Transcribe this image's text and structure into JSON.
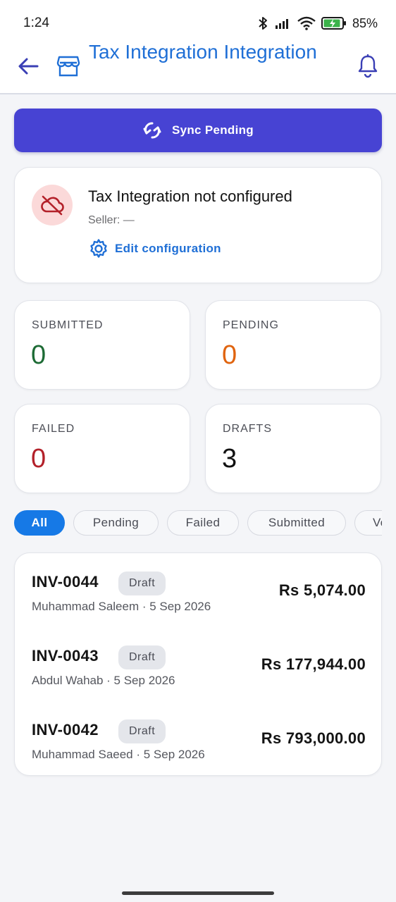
{
  "status_bar": {
    "time": "1:24",
    "battery": "85%"
  },
  "app_bar": {
    "title": "Tax Integration Integration",
    "icons": [
      "back-arrow-icon",
      "storefront-icon",
      "bell-icon"
    ]
  },
  "sync_button": {
    "label": "Sync Pending",
    "icon": "sync-icon"
  },
  "config_card": {
    "title": "Tax Integration not configured",
    "seller": "Seller: —",
    "edit_label": "Edit configuration",
    "icons": [
      "cloud-off-icon",
      "gear-icon"
    ]
  },
  "stats": [
    {
      "label": "SUBMITTED",
      "value": "0",
      "color": "#1d6b35"
    },
    {
      "label": "PENDING",
      "value": "0",
      "color": "#e0640f"
    },
    {
      "label": "FAILED",
      "value": "0",
      "color": "#b3212a"
    },
    {
      "label": "DRAFTS",
      "value": "3",
      "color": "#111111"
    }
  ],
  "filters": {
    "chips": [
      "All",
      "Pending",
      "Failed",
      "Submitted",
      "Void"
    ],
    "selected": "All"
  },
  "invoices": [
    {
      "id": "INV-0044",
      "status": "Draft",
      "meta": "Muhammad Saleem · 5 Sep 2026",
      "amount": "Rs 5,074.00"
    },
    {
      "id": "INV-0043",
      "status": "Draft",
      "meta": "Abdul Wahab · 5 Sep 2026",
      "amount": "Rs 177,944.00"
    },
    {
      "id": "INV-0042",
      "status": "Draft",
      "meta": "Muhammad Saeed · 5 Sep 2026",
      "amount": "Rs 793,000.00"
    }
  ],
  "colors": {
    "accent": "#1f6fd6",
    "primary_button": "#4743d3",
    "chip_active": "#1679e6",
    "error_bg": "#fbd9d9",
    "error_icon": "#b3212a"
  }
}
